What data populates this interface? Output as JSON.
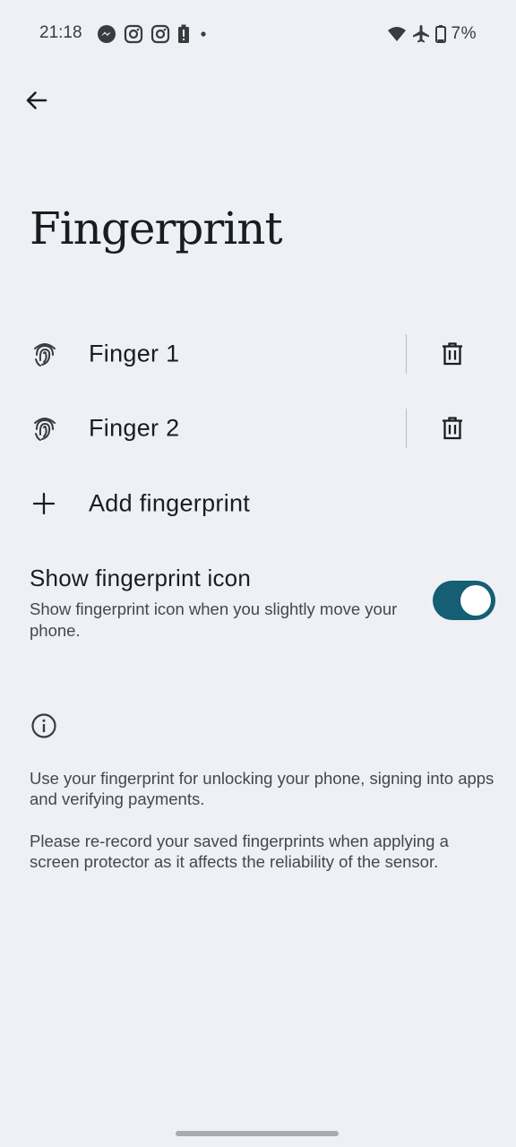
{
  "status_bar": {
    "time": "21:18",
    "battery_text": "7%",
    "notification_icons": [
      "messenger-icon",
      "instagram-icon",
      "instagram-icon",
      "battery-alert-icon",
      "dot-icon"
    ],
    "right_icons": [
      "wifi-icon",
      "airplane-icon",
      "battery-icon"
    ]
  },
  "header": {
    "title": "Fingerprint"
  },
  "fingerprints": [
    {
      "label": "Finger 1"
    },
    {
      "label": "Finger 2"
    }
  ],
  "add_fingerprint": {
    "label": "Add fingerprint"
  },
  "show_icon_setting": {
    "title": "Show fingerprint icon",
    "description": "Show fingerprint icon when you slightly move your phone.",
    "enabled": true
  },
  "info": {
    "paragraph_1": "Use your fingerprint for unlocking your phone, signing into apps and verifying payments.",
    "paragraph_2": "Please re-record your saved fingerprints when applying a screen protector as it affects the reliability of the sensor."
  },
  "colors": {
    "background": "#eef0f5",
    "accent": "#155e73"
  }
}
